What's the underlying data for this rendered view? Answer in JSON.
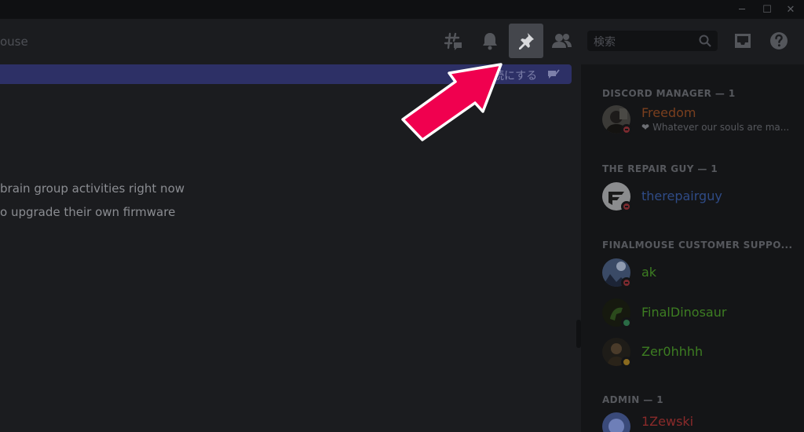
{
  "window": {
    "minimize_label": "─",
    "maximize_label": "☐",
    "close_label": "✕"
  },
  "header": {
    "channel_name": "ouse",
    "search_placeholder": "検索",
    "icons": [
      "threads-icon",
      "bell-icon",
      "pin-icon",
      "members-icon",
      "inbox-icon",
      "help-icon"
    ]
  },
  "banner": {
    "text": "読にする"
  },
  "chat": {
    "messages": [
      " brain group activities right now",
      "o upgrade their own firmware"
    ]
  },
  "member_list": {
    "groups": [
      {
        "title": "DISCORD MANAGER — 1",
        "members": [
          {
            "name": "Freedom",
            "status_text": "Whatever our souls are ma...",
            "name_color": "#7a3f1e",
            "presence": "dnd"
          }
        ]
      },
      {
        "title": "THE REPAIR GUY — 1",
        "members": [
          {
            "name": "therepairguy",
            "status_text": "",
            "name_color": "#2f4b86",
            "presence": "dnd"
          }
        ]
      },
      {
        "title": "FINALMOUSE CUSTOMER SUPPO...",
        "members": [
          {
            "name": "ak",
            "status_text": "",
            "name_color": "#3d7d22",
            "presence": "dnd"
          },
          {
            "name": "FinalDinosaur",
            "status_text": "",
            "name_color": "#3d7d22",
            "presence": "online"
          },
          {
            "name": "Zer0hhhh",
            "status_text": "",
            "name_color": "#3d7d22",
            "presence": "idle"
          }
        ]
      },
      {
        "title": "ADMIN — 1",
        "members": [
          {
            "name": "1Zewski",
            "status_text": "",
            "name_color": "#8a2a2a",
            "presence": "none"
          }
        ]
      }
    ]
  },
  "colors": {
    "background": "#1b1c1f",
    "member_list_bg": "#141517",
    "banner_bg": "#2d3066",
    "arrow_fill": "#f0004f",
    "pin_active_bg": "#44464c"
  }
}
